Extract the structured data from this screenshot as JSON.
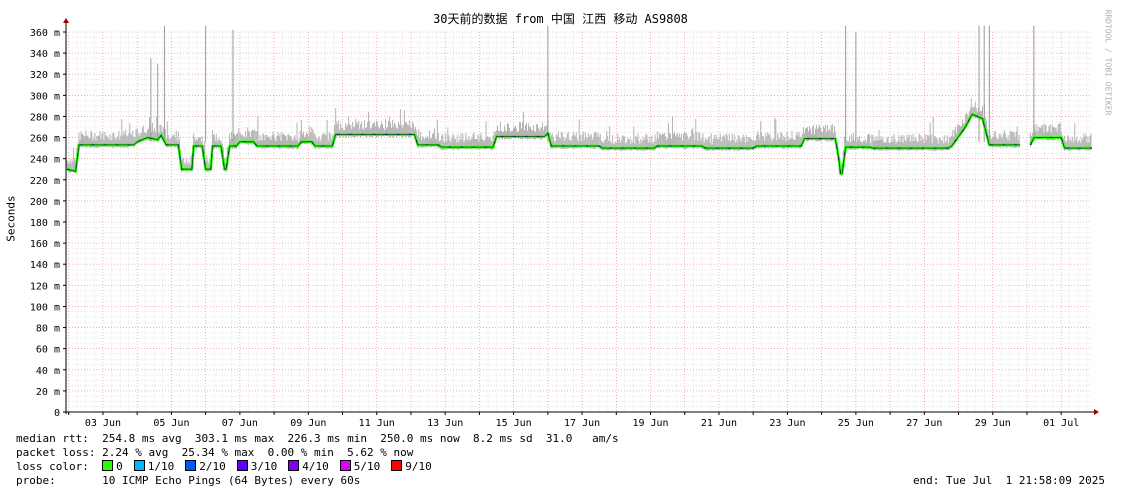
{
  "chart_data": {
    "type": "line",
    "title": "30天前的数据 from 中国 江西 移动 AS9808",
    "ylabel": "Seconds",
    "watermark": "RRDTOOL / TOBI OETIKER",
    "ylim": [
      0,
      360
    ],
    "y_ticks": [
      {
        "v": 0,
        "label": "0"
      },
      {
        "v": 20,
        "label": "20 m"
      },
      {
        "v": 40,
        "label": "40 m"
      },
      {
        "v": 60,
        "label": "60 m"
      },
      {
        "v": 80,
        "label": "80 m"
      },
      {
        "v": 100,
        "label": "100 m"
      },
      {
        "v": 120,
        "label": "120 m"
      },
      {
        "v": 140,
        "label": "140 m"
      },
      {
        "v": 160,
        "label": "160 m"
      },
      {
        "v": 180,
        "label": "180 m"
      },
      {
        "v": 200,
        "label": "200 m"
      },
      {
        "v": 220,
        "label": "220 m"
      },
      {
        "v": 240,
        "label": "240 m"
      },
      {
        "v": 260,
        "label": "260 m"
      },
      {
        "v": 280,
        "label": "280 m"
      },
      {
        "v": 300,
        "label": "300 m"
      },
      {
        "v": 320,
        "label": "320 m"
      },
      {
        "v": 340,
        "label": "340 m"
      },
      {
        "v": 360,
        "label": "360 m"
      }
    ],
    "x_ticks": [
      {
        "d": 3,
        "label": "03 Jun"
      },
      {
        "d": 5,
        "label": "05 Jun"
      },
      {
        "d": 7,
        "label": "07 Jun"
      },
      {
        "d": 9,
        "label": "09 Jun"
      },
      {
        "d": 11,
        "label": "11 Jun"
      },
      {
        "d": 13,
        "label": "13 Jun"
      },
      {
        "d": 15,
        "label": "15 Jun"
      },
      {
        "d": 17,
        "label": "17 Jun"
      },
      {
        "d": 19,
        "label": "19 Jun"
      },
      {
        "d": 21,
        "label": "21 Jun"
      },
      {
        "d": 23,
        "label": "23 Jun"
      },
      {
        "d": 25,
        "label": "25 Jun"
      },
      {
        "d": 27,
        "label": "27 Jun"
      },
      {
        "d": 29,
        "label": "29 Jun"
      },
      {
        "d": 31,
        "label": "01 Jul"
      }
    ],
    "x_range_days": [
      1.92,
      31.9
    ],
    "grid": true,
    "series": [
      {
        "description": "median rtt",
        "segments": [
          [
            [
              1.95,
              230
            ],
            [
              2.2,
              228
            ],
            [
              2.3,
              253
            ],
            [
              3.9,
              253
            ],
            [
              4.0,
              256
            ],
            [
              4.3,
              260
            ],
            [
              4.6,
              258
            ],
            [
              4.7,
              262
            ],
            [
              4.85,
              253
            ],
            [
              5.2,
              253
            ],
            [
              5.3,
              230
            ],
            [
              5.6,
              230
            ],
            [
              5.65,
              252
            ],
            [
              5.9,
              252
            ],
            [
              6.0,
              230
            ],
            [
              6.15,
              230
            ],
            [
              6.2,
              252
            ],
            [
              6.45,
              252
            ],
            [
              6.55,
              230
            ],
            [
              6.6,
              230
            ],
            [
              6.7,
              252
            ],
            [
              6.9,
              252
            ],
            [
              7.0,
              256
            ],
            [
              7.4,
              256
            ],
            [
              7.5,
              252
            ],
            [
              8.7,
              252
            ],
            [
              8.8,
              256
            ],
            [
              9.1,
              256
            ],
            [
              9.2,
              252
            ],
            [
              9.7,
              252
            ],
            [
              9.8,
              263
            ],
            [
              12.1,
              263
            ],
            [
              12.2,
              253
            ],
            [
              12.8,
              253
            ],
            [
              12.9,
              251
            ],
            [
              14.4,
              251
            ],
            [
              14.5,
              261
            ],
            [
              15.9,
              261
            ],
            [
              16.0,
              264
            ],
            [
              16.1,
              252
            ],
            [
              17.5,
              252
            ],
            [
              17.6,
              250
            ],
            [
              19.1,
              250
            ],
            [
              19.2,
              252
            ],
            [
              20.5,
              252
            ],
            [
              20.6,
              250
            ],
            [
              22.0,
              250
            ],
            [
              22.1,
              252
            ],
            [
              23.4,
              252
            ],
            [
              23.5,
              259
            ],
            [
              24.4,
              259
            ],
            [
              24.5,
              240
            ],
            [
              24.55,
              226
            ],
            [
              24.6,
              226
            ],
            [
              24.7,
              251
            ],
            [
              25.4,
              251
            ],
            [
              25.5,
              250
            ],
            [
              27.7,
              250
            ],
            [
              27.8,
              252
            ],
            [
              28.2,
              270
            ],
            [
              28.4,
              282
            ],
            [
              28.7,
              278
            ],
            [
              28.9,
              253
            ],
            [
              29.8,
              253
            ]
          ],
          [
            [
              30.1,
              253
            ],
            [
              30.2,
              260
            ],
            [
              31.0,
              260
            ],
            [
              31.1,
              250
            ],
            [
              31.9,
              250
            ]
          ]
        ]
      }
    ],
    "loss_colors": {
      "0": "#26ff00",
      "1/10": "#00b8ff",
      "2/10": "#0059ff",
      "3/10": "#5e00ff",
      "4/10": "#7e00ff",
      "5/10": "#dd00ff",
      "9/10": "#ff0000"
    },
    "spikes": [
      {
        "d": 4.4,
        "top": 335
      },
      {
        "d": 4.6,
        "top": 330
      },
      {
        "d": 4.8,
        "top": 367
      },
      {
        "d": 6.0,
        "top": 367
      },
      {
        "d": 6.8,
        "top": 362
      },
      {
        "d": 16.0,
        "top": 367
      },
      {
        "d": 24.7,
        "top": 367
      },
      {
        "d": 25.0,
        "top": 360
      },
      {
        "d": 28.6,
        "top": 367
      },
      {
        "d": 28.75,
        "top": 367
      },
      {
        "d": 28.9,
        "top": 367
      },
      {
        "d": 30.2,
        "top": 367
      }
    ]
  },
  "stats": {
    "median_label": "median rtt:",
    "median_text": "254.8 ms avg  303.1 ms max  226.3 ms min  250.0 ms now  8.2 ms sd  31.0   am/s",
    "loss_label": "packet loss:",
    "loss_text": "2.24 % avg  25.34 % max  0.00 % min  5.62 % now",
    "color_label": "loss color:",
    "legend": [
      {
        "label": "0",
        "color": "#26ff00"
      },
      {
        "label": "1/10",
        "color": "#00b8ff"
      },
      {
        "label": "2/10",
        "color": "#0059ff"
      },
      {
        "label": "3/10",
        "color": "#5e00ff"
      },
      {
        "label": "4/10",
        "color": "#7e00ff"
      },
      {
        "label": "5/10",
        "color": "#dd00ff"
      },
      {
        "label": "9/10",
        "color": "#ff0000"
      }
    ],
    "probe_label": "probe:",
    "probe_text": "10 ICMP Echo Pings (64 Bytes) every 60s",
    "end_text": "end: Tue Jul  1 21:58:09 2025"
  }
}
